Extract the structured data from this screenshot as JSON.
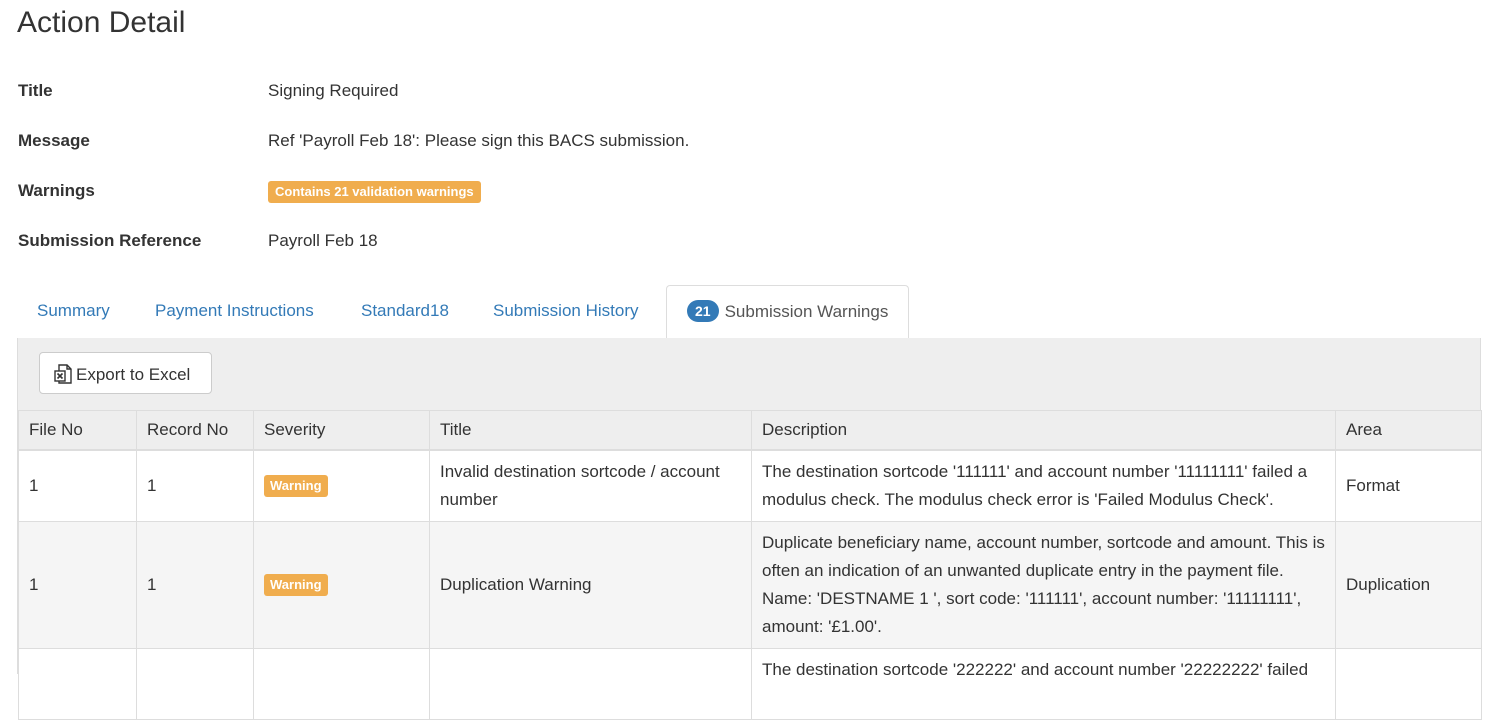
{
  "page": {
    "title": "Action Detail"
  },
  "details": {
    "title_label": "Title",
    "title_value": "Signing Required",
    "message_label": "Message",
    "message_value": "Ref 'Payroll Feb 18': Please sign this BACS submission.",
    "warnings_label": "Warnings",
    "warnings_badge": "Contains 21 validation warnings",
    "submission_ref_label": "Submission Reference",
    "submission_ref_value": "Payroll Feb 18"
  },
  "tabs": [
    {
      "label": "Summary"
    },
    {
      "label": "Payment Instructions"
    },
    {
      "label": "Standard18"
    },
    {
      "label": "Submission History"
    },
    {
      "label": "Submission Warnings",
      "count": "21",
      "active": true
    }
  ],
  "toolbar": {
    "export_label": "Export to Excel",
    "export_icon": "excel-file-icon"
  },
  "table": {
    "columns": [
      "File No",
      "Record No",
      "Severity",
      "Title",
      "Description",
      "Area"
    ],
    "rows": [
      {
        "file_no": "1",
        "record_no": "1",
        "severity": "Warning",
        "title": "Invalid destination sortcode / account number",
        "description": "The destination sortcode '111111' and account number '11111111' failed a modulus check. The modulus check error is 'Failed Modulus Check'.",
        "area": "Format"
      },
      {
        "file_no": "1",
        "record_no": "1",
        "severity": "Warning",
        "title": "Duplication Warning",
        "description": "Duplicate beneficiary name, account number, sortcode and amount. This is often an indication of an unwanted duplicate entry in the payment file. Name: 'DESTNAME 1 ', sort code: '111111', account number: '11111111', amount: '£1.00'.",
        "area": "Duplication"
      },
      {
        "file_no": "",
        "record_no": "",
        "severity": "",
        "title": "",
        "description": "The destination sortcode '222222' and account number '22222222' failed",
        "area": ""
      }
    ]
  },
  "colors": {
    "link": "#337ab7",
    "warning": "#f0ad4e",
    "badge": "#337ab7"
  }
}
